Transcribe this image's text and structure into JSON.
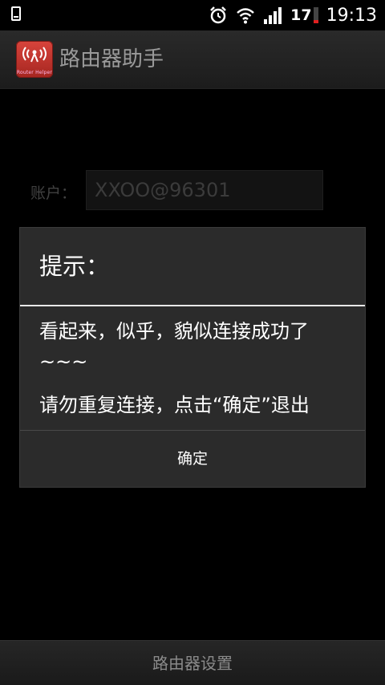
{
  "status_bar": {
    "battery_level": "17",
    "time": "19:13",
    "icons": [
      "phone-storage-icon",
      "alarm-clock-icon",
      "wifi-icon",
      "signal-icon"
    ]
  },
  "action_bar": {
    "title": "路由器助手",
    "app_icon_caption": "Router Helper"
  },
  "form": {
    "account_label": "账户：",
    "account_value": "XXOO@96301"
  },
  "dialog": {
    "title": "提示：",
    "message_line1": "看起来，似乎，貌似连接成功了",
    "message_line2": "~~~",
    "message_line3": "请勿重复连接，点击“确定”退出",
    "ok_label": "确定"
  },
  "bottom_bar": {
    "label": "路由器设置"
  },
  "colors": {
    "accent_red": "#d8443c",
    "dialog_bg": "#2b2b2b",
    "battery_low": "#e02020"
  }
}
